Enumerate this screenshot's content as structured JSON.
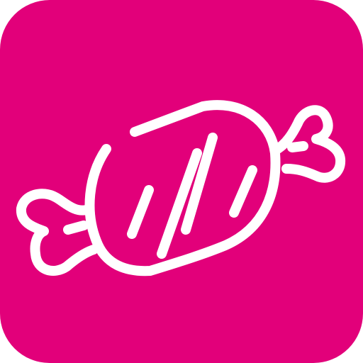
{
  "icon": {
    "name": "candy-icon",
    "background_color": "#E2007A",
    "stroke_color": "#FFFFFF"
  }
}
